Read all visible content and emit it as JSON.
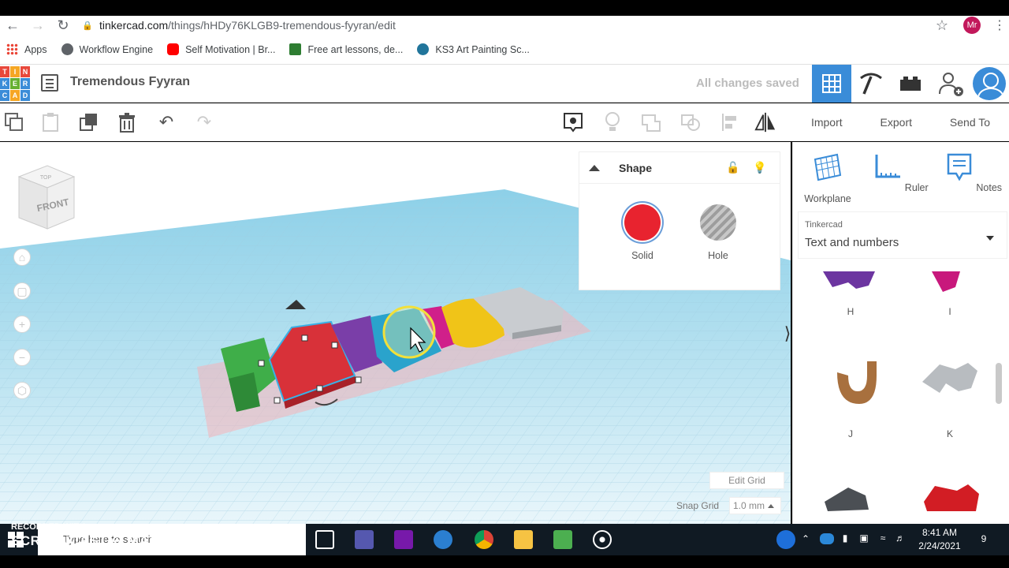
{
  "browser": {
    "url_domain": "tinkercad.com",
    "url_path": "/things/hHDy76KLGB9-tremendous-fyyran/edit",
    "profile_initials": "Mr"
  },
  "bookmarks": [
    {
      "label": "Apps",
      "icon": "apps-grid-icon",
      "color": "#ea4335"
    },
    {
      "label": "Workflow Engine",
      "icon": "globe-icon",
      "color": "#5f6368"
    },
    {
      "label": "Self Motivation | Br...",
      "icon": "youtube-icon",
      "color": "#ff0000"
    },
    {
      "label": "Free art lessons, de...",
      "icon": "artsite-icon",
      "color": "#2e7d32"
    },
    {
      "label": "KS3 Art Painting Sc...",
      "icon": "wordpress-icon",
      "color": "#21759b"
    }
  ],
  "header": {
    "logo_letters": [
      "T",
      "I",
      "N",
      "K",
      "E",
      "R",
      "C",
      "A",
      "D"
    ],
    "logo_colors": [
      "#e8483b",
      "#f6a623",
      "#e8483b",
      "#3a8cd8",
      "#66b032",
      "#3a8cd8",
      "#3a8cd8",
      "#f6a623",
      "#3a8cd8"
    ],
    "design_title": "Tremendous Fyyran",
    "save_status": "All changes saved",
    "accent": "#3a8cd8"
  },
  "toolbar": {
    "left_tools": [
      "copy-icon",
      "paste-icon",
      "duplicate-icon",
      "delete-icon",
      "undo-icon",
      "redo-icon"
    ],
    "right_tools": [
      "notes-toggle-icon",
      "light-icon",
      "group-icon",
      "ungroup-icon",
      "align-icon",
      "mirror-icon"
    ],
    "actions": {
      "import": "Import",
      "export": "Export",
      "send_to": "Send To"
    }
  },
  "viewcube": {
    "face_top": "TOP",
    "face_front": "FRONT"
  },
  "shape_panel": {
    "title": "Shape",
    "solid_label": "Solid",
    "hole_label": "Hole",
    "solid_color": "#e8232f"
  },
  "workplane": {
    "edit_grid": "Edit Grid",
    "snap_grid_label": "Snap Grid",
    "snap_grid_value": "1.0 mm"
  },
  "right_panel": {
    "tools": [
      {
        "label": "Workplane",
        "icon": "workplane-icon"
      },
      {
        "label": "Ruler",
        "icon": "ruler-icon"
      },
      {
        "label": "Notes",
        "icon": "notes-icon"
      }
    ],
    "library_source": "Tinkercad",
    "library_category": "Text and numbers",
    "letters": [
      "H",
      "I",
      "J",
      "K"
    ]
  },
  "taskbar": {
    "search_placeholder": "Type here to search",
    "time": "8:41 AM",
    "date": "2/24/2021",
    "notifications": "9"
  },
  "watermark": {
    "line1": "RECORDED WITH",
    "line2": "SCREENCAST ◎ MATIC"
  }
}
